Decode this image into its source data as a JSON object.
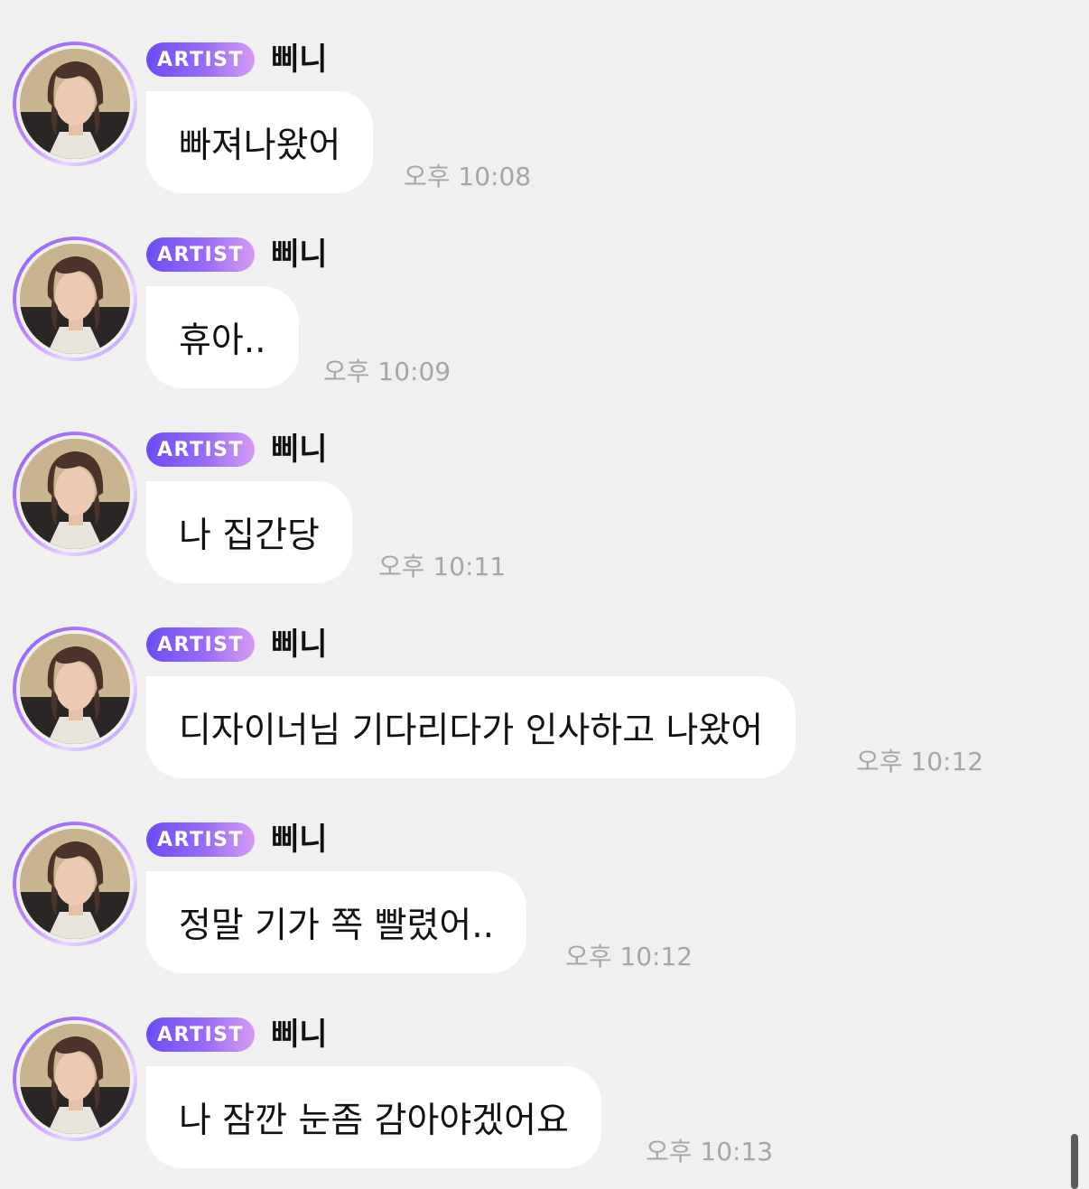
{
  "badge_label": "ARTIST",
  "sender_name": "삐니",
  "messages": [
    {
      "text": "빠져나왔어",
      "time": "오후 10:08"
    },
    {
      "text": "휴아..",
      "time": "오후 10:09"
    },
    {
      "text": "나 집간당",
      "time": "오후 10:11"
    },
    {
      "text": "디자이너님 기다리다가 인사하고 나왔어",
      "time": "오후 10:12"
    },
    {
      "text": "정말 기가 쪽 빨렸어..",
      "time": "오후 10:12"
    },
    {
      "text": "나 잠깐 눈좀 감아야겠어요",
      "time": "오후 10:13"
    }
  ],
  "colors": {
    "background": "#f0f0f0",
    "bubble": "#ffffff",
    "badge_start": "#6d4cf5",
    "badge_end": "#d59cf3",
    "timestamp": "#a6a6a6"
  },
  "icons": {
    "avatar": "profile-photo"
  }
}
